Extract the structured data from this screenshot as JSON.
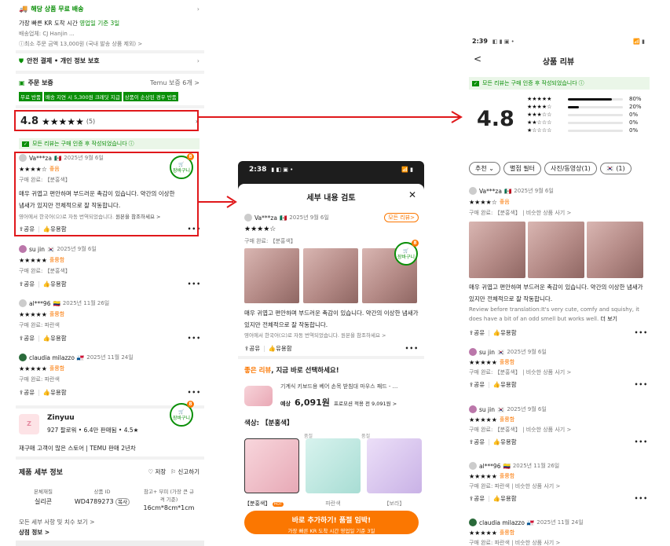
{
  "left": {
    "shipping_title": "해당 상품 무료 배송",
    "shipping_sub_a": "가장 빠른 KR 도착 시간 ",
    "shipping_sub_b": "영업일 기준 3일",
    "carriers": "배송업체:  CJ  Hanjin ...",
    "min_order": "ⓘ최소 주문 금액 13,000원 (국내 발송 상품 제외) >",
    "safe_pay": "안전 결제 • 개인 정보 보호",
    "order_guard": "주문 보증",
    "order_guard_link": "Temu 보증 6개 >",
    "guard_tags": [
      "무료 반품",
      "배송 지연 시 5,300원 크레딧 지급",
      "상품이 손상된 경우 반품"
    ],
    "rating": "4.8",
    "rating_stars": "★★★★★",
    "rating_count": "(5)",
    "verified": "모든 리뷰는 구매 인증 후 작성되었습니다",
    "cart_label": "장바구니",
    "cart_sub": "무료배송",
    "cart_count": "8",
    "reviews": [
      {
        "name": "Va***za",
        "flag": "🇲🇽",
        "date": "2025년 9월 6일",
        "stars": "★★★★☆",
        "tag": "좋음",
        "meta": "구매 완료: 【분홍색】",
        "body": "매우 귀엽고 편안하며 부드러운 촉감이 있습니다. 약간의 이상한 냄새가 있지만 전체적으로 잘 작동합니다.",
        "trans": "영어에서 한국어(으)로 자동 번역되었습니다.",
        "orig": "원본을 참조하세요 >"
      },
      {
        "name": "su jin",
        "flag": "🇰🇷",
        "date": "2025년 9월 6일",
        "stars": "★★★★★",
        "tag": "훌륭함",
        "meta": "구매 완료: 【분홍색】"
      },
      {
        "name": "al***96",
        "flag": "🇨🇴",
        "date": "2025년 11월 26일",
        "stars": "★★★★★",
        "tag": "훌륭함",
        "meta": "구매 완료: 파란색"
      },
      {
        "name": "claudia milazzo",
        "flag": "🇵🇦",
        "date": "2025년 11월 24일",
        "stars": "★★★★★",
        "tag": "훌륭함",
        "meta": "구매 완료: 파란색"
      }
    ],
    "share": "공유",
    "helpful": "유용함",
    "more": "•••",
    "seller_name": "Zinyuu",
    "seller_stats": "927 팔로워  •  6.4만 판매됨  •  4.5★",
    "seller_tags": "재구매 고객이 많은 스토어  |  TEMU 판매 2년차",
    "detail_title": "제품 세부 정보",
    "save": "♡ 저장",
    "report": "신고하기",
    "spec_labels": [
      "본체재질",
      "상품 ID",
      "참고+ 부피 (가장 큰 규격 기준)"
    ],
    "spec_values": [
      "실리콘",
      "WD4789273",
      "16cm*8cm*1cm"
    ],
    "copy": "복사",
    "all_details": "모든 세부 사항 및 치수 보기 >",
    "product_info": "상점 정보 >"
  },
  "mid": {
    "time": "2:38",
    "title": "세부 내용 검토",
    "close": "✕",
    "reviewer": "Va***za",
    "flag": "🇲🇽",
    "date": "2025년 9월 6일",
    "all_reviews": "모든 리뷰>",
    "stars": "★★★★☆",
    "meta": "구매 완료: 【분홍색】",
    "body": "매우 귀엽고 편안하며 부드러운 촉감이 있습니다. 약간의 이상한 냄새가 있지만 전체적으로 잘 작동합니다.",
    "trans": "영어에서 한국어(으)로 자동 번역되었습니다.  원본을 참조하세요 >",
    "share": "공유",
    "helpful": "유용함",
    "promo_a": "좋은 리뷰",
    "promo_b": ", 지금 바로 선택하세요!",
    "product_name": "기계식 키보드용 베어 손목 받침대 마우스 패드 - ...",
    "price_label": "예상",
    "price": "6,091원",
    "price_note": "프로모션 적용 전 9,091원 >",
    "color_label": "색상: 【분홍색】",
    "swatches": [
      "【분홍색】",
      "파란색",
      "【보라】"
    ],
    "swatch_tag": "HOT",
    "swatch_small": "품절",
    "cta": "바로 추가하기! 품절 임박!",
    "cta_sub": "가장 빠른 KR 도착 시간 영업일 기준 3일"
  },
  "right": {
    "time": "2:39",
    "title": "상품 리뷰",
    "back": "<",
    "verified": "모든 리뷰는 구매 인증 후 작성되었습니다",
    "rating": "4.8",
    "bars": [
      {
        "stars": "★★★★★",
        "pct": "80%",
        "v": 0.8
      },
      {
        "stars": "★★★★☆",
        "pct": "20%",
        "v": 0.2
      },
      {
        "stars": "★★★☆☆",
        "pct": "0%",
        "v": 0
      },
      {
        "stars": "★★☆☆☆",
        "pct": "0%",
        "v": 0
      },
      {
        "stars": "★☆☆☆☆",
        "pct": "0%",
        "v": 0
      }
    ],
    "filters": [
      "추천",
      "별점 필터",
      "사진/동영상(1)",
      "(1)"
    ],
    "reviews": [
      {
        "name": "Va***za",
        "flag": "🇲🇽",
        "date": "2025년 9월 6일",
        "stars": "★★★★☆",
        "tag": "좋음",
        "meta": "구매 완료: 【분홍색】 | 비슷한 상품 사기 >"
      },
      {
        "name": "su jin",
        "flag": "🇰🇷",
        "date": "2025년 9월 6일",
        "stars": "★★★★★",
        "tag": "훌륭함",
        "meta": "구매 완료: 【분홍색】 | 비슷한 상품 사기 >"
      },
      {
        "name": "su jin",
        "flag": "🇰🇷",
        "date": "2025년 9월 6일",
        "stars": "★★★★★",
        "tag": "훌륭함",
        "meta": "구매 완료: 【분홍색】 | 비슷한 상품 사기 >"
      },
      {
        "name": "al***96",
        "flag": "🇨🇴",
        "date": "2025년 11월 26일",
        "stars": "★★★★★",
        "tag": "훌륭함",
        "meta": "구매 완료: 파란색 | 비슷한 상품 사기 >"
      },
      {
        "name": "claudia milazzo",
        "flag": "🇵🇦",
        "date": "2025년 11월 24일",
        "stars": "★★★★★",
        "tag": "훌륭함",
        "meta": "구매 완료: 파란색 | 비슷한 상품 사기 >"
      }
    ],
    "body": "매우 귀엽고 편안하며 부드러운 촉감이 있습니다. 약간의 이상한 냄새가 있지만 전체적으로 잘 작동합니다.",
    "review_en": "Review before translation:It's very cute, comfy and squishy, it does have a bit of an odd smell but works well.",
    "more_text": "더 보기",
    "share": "공유",
    "helpful": "유용함"
  },
  "colors": {
    "accent": "#fb7701",
    "green": "#0a8f08",
    "highlight": "#e0181b"
  }
}
